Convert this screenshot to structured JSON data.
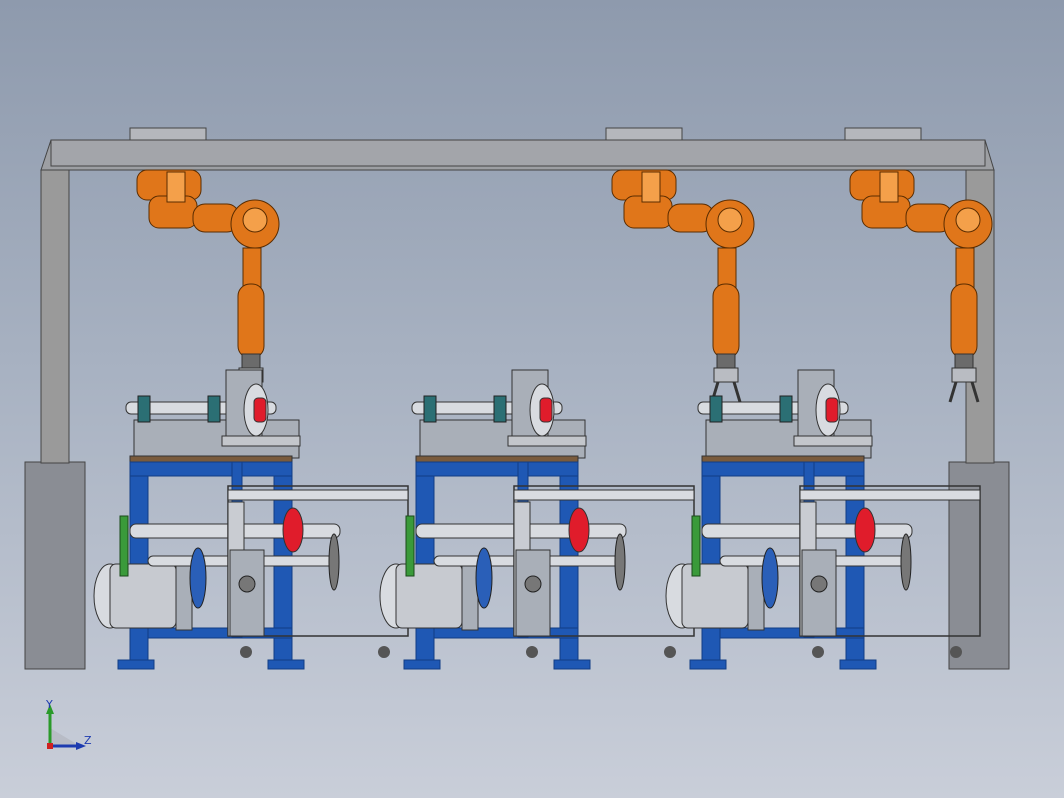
{
  "viewport": {
    "background_top": "#8e9aad",
    "background_bottom": "#c9ced9"
  },
  "colors": {
    "frame_gray": "#9a9a9a",
    "frame_dark": "#555555",
    "robot_orange": "#e0761a",
    "robot_orange_light": "#f4a04a",
    "stand_blue": "#1f58b4",
    "stand_blue_dark": "#123d85",
    "flange_red": "#e01c2b",
    "metal_light": "#d8dbe0",
    "metal_mid": "#a9afb8",
    "teal": "#2b6f74",
    "pedestal": "#8a8d94"
  },
  "robots": {
    "count": 3,
    "icon": "industrial-robot-arm-icon"
  },
  "stations": {
    "count": 3
  },
  "axis_triad": {
    "x_label": "Y",
    "z_label": "Z",
    "icon": "axis-triad-icon"
  }
}
